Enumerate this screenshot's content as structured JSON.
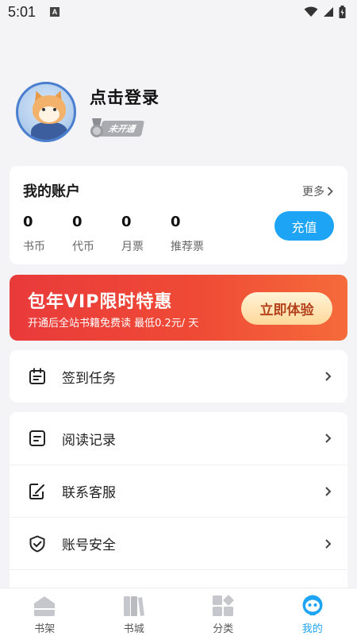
{
  "status_bar": {
    "time": "5:01",
    "notification_icon": "A"
  },
  "profile": {
    "login_label": "点击登录",
    "member_status": "未开通"
  },
  "account": {
    "title": "我的账户",
    "more_label": "更多",
    "stats": [
      {
        "value": "0",
        "label": "书币"
      },
      {
        "value": "0",
        "label": "代币"
      },
      {
        "value": "0",
        "label": "月票"
      },
      {
        "value": "0",
        "label": "推荐票"
      }
    ],
    "recharge_label": "充值"
  },
  "vip_banner": {
    "title": "包年VIP限时特惠",
    "subtitle": "开通后全站书籍免费读 最低0.2元/ 天",
    "button_label": "立即体验"
  },
  "menu": {
    "task": {
      "label": "签到任务",
      "icon": "calendar-icon"
    },
    "items": [
      {
        "label": "阅读记录",
        "icon": "reading-history-icon"
      },
      {
        "label": "联系客服",
        "icon": "edit-note-icon"
      },
      {
        "label": "账号安全",
        "icon": "shield-check-icon"
      }
    ]
  },
  "bottom_nav": [
    {
      "label": "书架",
      "icon": "home-icon",
      "active": false
    },
    {
      "label": "书城",
      "icon": "books-icon",
      "active": false
    },
    {
      "label": "分类",
      "icon": "category-icon",
      "active": false
    },
    {
      "label": "我的",
      "icon": "profile-face-icon",
      "active": true
    }
  ],
  "colors": {
    "accent": "#1ea4f4",
    "vip_gradient_start": "#e93a3a",
    "vip_gradient_end": "#f56b3a",
    "vip_button_text": "#b4421c"
  }
}
